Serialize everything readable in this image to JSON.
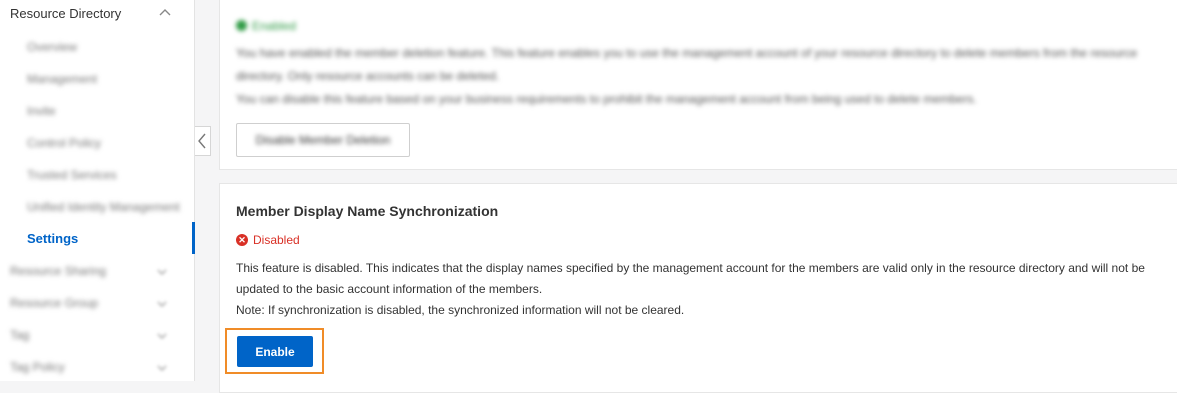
{
  "sidebar": {
    "section_title": "Resource Directory",
    "items": [
      {
        "label": "Overview"
      },
      {
        "label": "Management"
      },
      {
        "label": "Invite"
      },
      {
        "label": "Control Policy"
      },
      {
        "label": "Trusted Services"
      },
      {
        "label": "Unified Identity Management"
      },
      {
        "label": "Settings"
      }
    ],
    "groups": [
      {
        "label": "Resource Sharing"
      },
      {
        "label": "Resource Group"
      },
      {
        "label": "Tag"
      },
      {
        "label": "Tag Policy"
      }
    ]
  },
  "card1": {
    "status": "Enabled",
    "line1": "You have enabled the member deletion feature. This feature enables you to use the management account of your resource directory to delete members from the resource",
    "line2": "directory. Only resource accounts can be deleted.",
    "line3": "You can disable this feature based on your business requirements to prohibit the management account from being used to delete members.",
    "button": "Disable Member Deletion"
  },
  "card2": {
    "title": "Member Display Name Synchronization",
    "status": "Disabled",
    "line1": "This feature is disabled. This indicates that the display names specified by the management account for the members are valid only in the resource directory and will not be",
    "line2": "updated to the basic account information of the members.",
    "line3": "Note: If synchronization is disabled, the synchronized information will not be cleared.",
    "button": "Enable"
  }
}
